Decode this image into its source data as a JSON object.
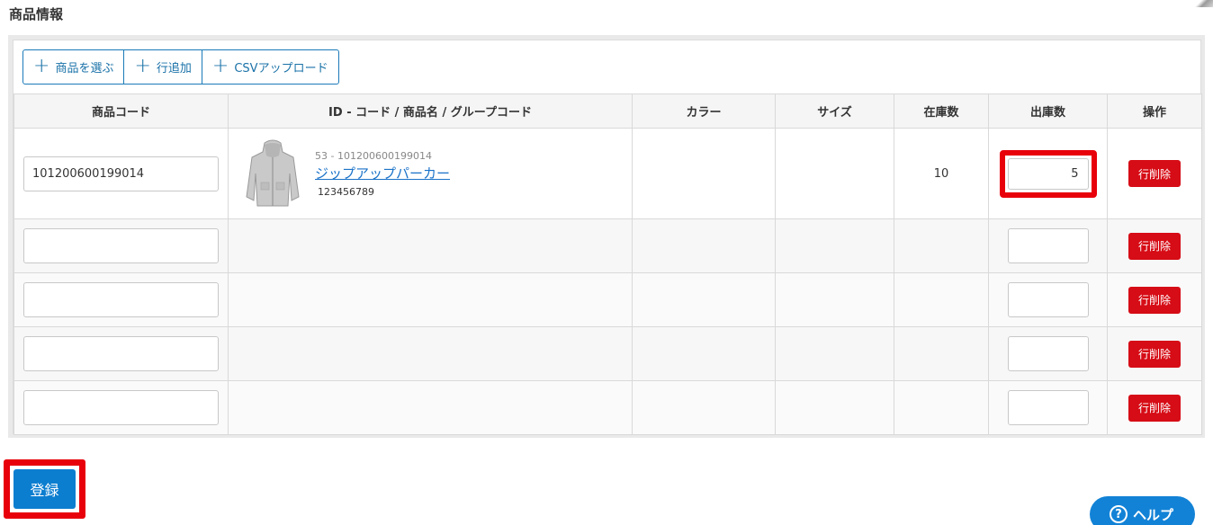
{
  "section_title": "商品情報",
  "toolbar": {
    "select_product": "商品を選ぶ",
    "add_row": "行追加",
    "csv_upload": "CSVアップロード"
  },
  "table": {
    "headers": [
      "商品コード",
      "ID - コード / 商品名 / グループコード",
      "カラー",
      "サイズ",
      "在庫数",
      "出庫数",
      "操作"
    ],
    "rows": [
      {
        "code": "101200600199014",
        "product_id": "53 - 101200600199014",
        "product_name": "ジップアップパーカー",
        "group_code": "123456789",
        "color": "",
        "size": "",
        "stock": "10",
        "qty": "5",
        "delete_label": "行削除"
      },
      {
        "code": "",
        "qty": "",
        "delete_label": "行削除"
      },
      {
        "code": "",
        "qty": "",
        "delete_label": "行削除"
      },
      {
        "code": "",
        "qty": "",
        "delete_label": "行削除"
      },
      {
        "code": "",
        "qty": "",
        "delete_label": "行削除"
      }
    ]
  },
  "submit_label": "登録",
  "help_label": "ヘルプ",
  "icons": {
    "add": "plus-icon",
    "help": "question-circle-icon",
    "thumbnail": "hoodie-image"
  },
  "colors": {
    "accent": "#1a7ab8",
    "danger": "#d60c16",
    "highlight": "#e8000b",
    "primary": "#0c7ed0"
  }
}
